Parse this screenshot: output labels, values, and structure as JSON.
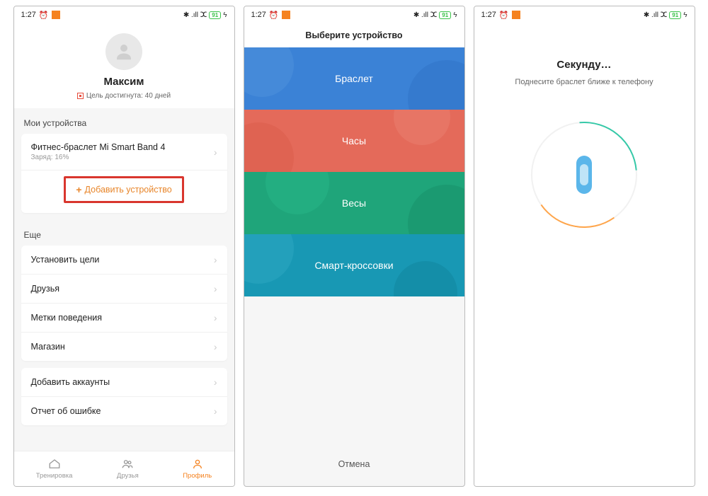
{
  "status": {
    "time": "1:27",
    "icons": "⁂ ✱ .ıll ⵆ",
    "battery": "91"
  },
  "screen1": {
    "username": "Максим",
    "goal": "Цель достигнута: 40 дней",
    "section_devices": "Мои устройства",
    "device_name": "Фитнес-браслет Mi Smart Band 4",
    "device_sub": "Заряд: 16%",
    "add_device": "Добавить устройство",
    "section_more": "Еще",
    "more": [
      "Установить цели",
      "Друзья",
      "Метки поведения",
      "Магазин"
    ],
    "extra": [
      "Добавить аккаунты",
      "Отчет об ошибке"
    ],
    "tabs": [
      "Тренировка",
      "Друзья",
      "Профиль"
    ]
  },
  "screen2": {
    "header": "Выберите устройство",
    "tiles": [
      "Браслет",
      "Часы",
      "Весы",
      "Смарт-кроссовки"
    ],
    "cancel": "Отмена"
  },
  "screen3": {
    "title": "Секунду…",
    "sub": "Поднесите браслет ближе к телефону"
  }
}
